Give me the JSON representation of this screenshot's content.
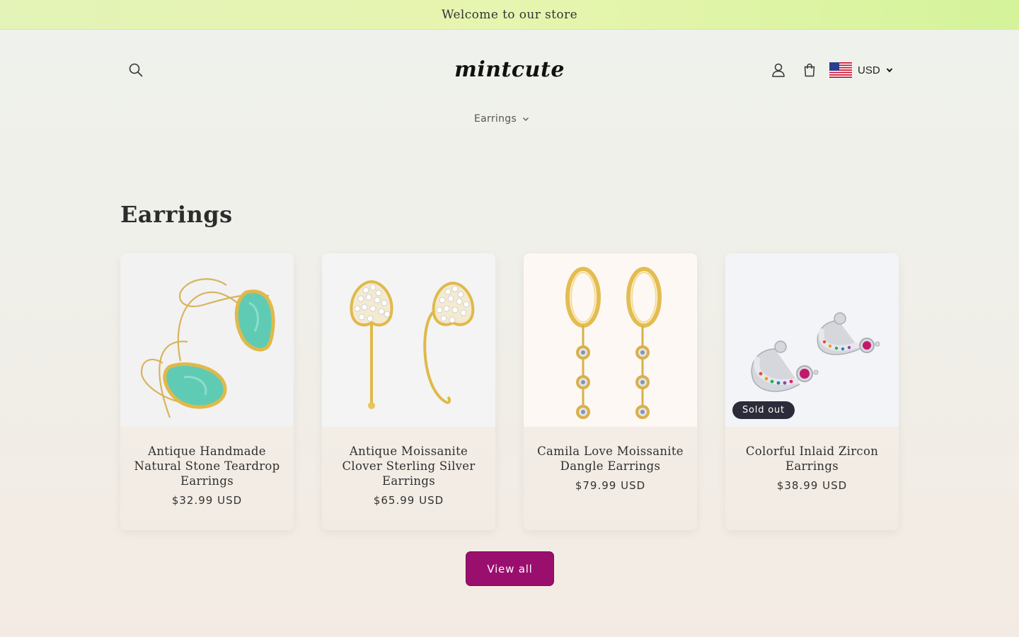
{
  "announcement": "Welcome to our store",
  "header": {
    "logo_text": "mintcute",
    "currency": "USD",
    "icons": [
      "search-icon",
      "account-icon",
      "cart-icon",
      "us-flag-icon",
      "chevron-down-icon"
    ]
  },
  "nav": {
    "items": [
      {
        "label": "Earrings"
      }
    ]
  },
  "section": {
    "title": "Earrings",
    "products": [
      {
        "title": "Antique Handmade Natural Stone Teardrop Earrings",
        "price": "$32.99 USD",
        "badge": ""
      },
      {
        "title": "Antique Moissanite Clover Sterling Silver Earrings",
        "price": "$65.99 USD",
        "badge": ""
      },
      {
        "title": "Camila Love Moissanite Dangle Earrings",
        "price": "$79.99 USD",
        "badge": ""
      },
      {
        "title": "Colorful Inlaid Zircon Earrings",
        "price": "$38.99 USD",
        "badge": "Sold out"
      }
    ],
    "view_all_label": "View all"
  },
  "colors": {
    "accent_button": "#9a0f6e",
    "announcement_bg": "#e4f3b7",
    "badge_bg": "#2b2b3a",
    "turquoise_stone": "#5fcbb4",
    "gold": "#e0b94a"
  }
}
